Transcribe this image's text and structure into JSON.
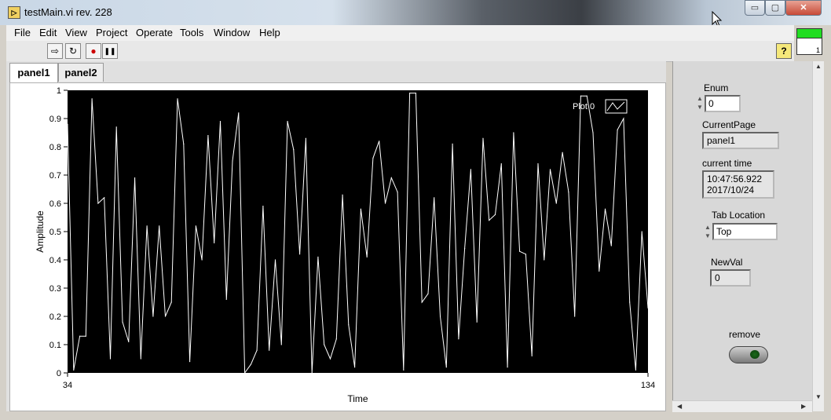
{
  "window": {
    "title": "testMain.vi rev. 228",
    "min_glyph": "▭",
    "max_glyph": "▢",
    "close_glyph": "✕",
    "icon_num": "1"
  },
  "menu": [
    "File",
    "Edit",
    "View",
    "Project",
    "Operate",
    "Tools",
    "Window",
    "Help"
  ],
  "toolbar": {
    "buttons": [
      {
        "name": "run-arrow-icon",
        "glyph": "⇨"
      },
      {
        "name": "run-continuously-icon",
        "glyph": "↻"
      },
      {
        "name": "abort-icon",
        "glyph": "●"
      },
      {
        "name": "pause-icon",
        "glyph": "❚❚"
      }
    ],
    "help_glyph": "?"
  },
  "tabs": [
    {
      "label": "panel1",
      "selected": true
    },
    {
      "label": "panel2",
      "selected": false
    }
  ],
  "controls": {
    "enum": {
      "label": "Enum",
      "value": "0"
    },
    "current_page": {
      "label": "CurrentPage",
      "value": "panel1"
    },
    "current_time": {
      "label": "current time",
      "value": "10:47:56.922\n2017/10/24"
    },
    "tab_location": {
      "label": "Tab Location",
      "value": "Top"
    },
    "new_val": {
      "label": "NewVal",
      "value": "0"
    },
    "remove": {
      "label": "remove"
    }
  },
  "colors": {
    "plot_bg": "#000000",
    "plot_line": "#ffffff"
  },
  "chart_data": {
    "type": "line",
    "xlabel": "Time",
    "ylabel": "Amplitude",
    "x_start": 34,
    "x_end": 134,
    "ylim": [
      0,
      1
    ],
    "y_ticks": [
      "0",
      "0.1",
      "0.2",
      "0.3",
      "0.4",
      "0.5",
      "0.6",
      "0.7",
      "0.8",
      "0.9",
      "1"
    ],
    "x_ticks": [
      "34",
      "134"
    ],
    "grid": false,
    "legend": "top-right",
    "series": [
      {
        "name": "Plot 0",
        "values": [
          0.88,
          0.01,
          0.13,
          0.13,
          0.97,
          0.6,
          0.62,
          0.05,
          0.87,
          0.18,
          0.11,
          0.69,
          0.05,
          0.52,
          0.2,
          0.52,
          0.2,
          0.25,
          0.97,
          0.81,
          0.04,
          0.52,
          0.4,
          0.84,
          0.46,
          0.89,
          0.26,
          0.75,
          0.92,
          0.0,
          0.03,
          0.08,
          0.59,
          0.08,
          0.4,
          0.1,
          0.89,
          0.79,
          0.42,
          0.83,
          0.0,
          0.41,
          0.1,
          0.05,
          0.12,
          0.63,
          0.17,
          0.02,
          0.58,
          0.41,
          0.76,
          0.82,
          0.6,
          0.69,
          0.64,
          0.01,
          0.99,
          0.99,
          0.25,
          0.28,
          0.62,
          0.2,
          0.02,
          0.81,
          0.12,
          0.44,
          0.72,
          0.18,
          0.83,
          0.54,
          0.56,
          0.74,
          0.02,
          0.85,
          0.43,
          0.42,
          0.06,
          0.74,
          0.4,
          0.72,
          0.6,
          0.78,
          0.64,
          0.2,
          0.98,
          0.98,
          0.85,
          0.36,
          0.58,
          0.45,
          0.86,
          0.9,
          0.25,
          0.01,
          0.5,
          0.23
        ]
      }
    ]
  }
}
